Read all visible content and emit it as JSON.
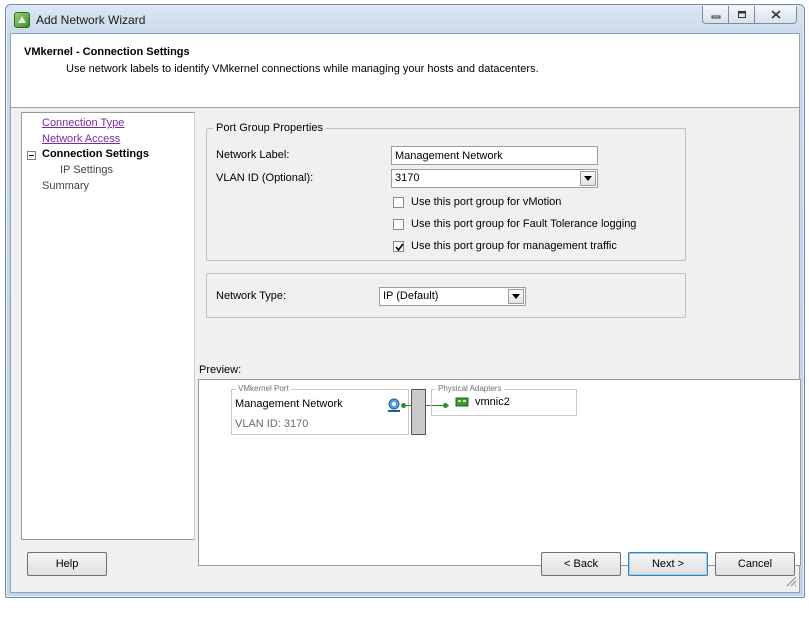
{
  "window": {
    "title": "Add Network Wizard",
    "buttons": {
      "minimize": "minimize",
      "maximize": "maximize",
      "close": "close"
    }
  },
  "header": {
    "title": "VMkernel - Connection Settings",
    "description": "Use network labels to identify VMkernel connections while managing your hosts and datacenters."
  },
  "nav": {
    "items": [
      {
        "label": "Connection Type",
        "state": "visited"
      },
      {
        "label": "Network Access",
        "state": "visited"
      },
      {
        "label": "Connection Settings",
        "state": "current"
      },
      {
        "label": "IP Settings",
        "state": "sub"
      },
      {
        "label": "Summary",
        "state": "pending"
      }
    ]
  },
  "port_group": {
    "legend": "Port Group Properties",
    "network_label_caption": "Network Label:",
    "network_label_value": "Management Network",
    "vlan_caption": "VLAN ID (Optional):",
    "vlan_value": "3170",
    "checkboxes": [
      {
        "label": "Use this port group for vMotion",
        "checked": false
      },
      {
        "label": "Use this port group for Fault Tolerance logging",
        "checked": false
      },
      {
        "label": "Use this port group for management traffic",
        "checked": true
      }
    ]
  },
  "network_type": {
    "caption": "Network Type:",
    "value": "IP (Default)"
  },
  "preview": {
    "label": "Preview:",
    "vmkernel_caption": "VMkernel Port",
    "port_name": "Management Network",
    "vlan_text": "VLAN ID: 3170",
    "physical_caption": "Physical Adapters",
    "adapter": "vmnic2",
    "link_color": "#2f8a2f"
  },
  "buttons": {
    "help": "Help",
    "back": "< Back",
    "next": "Next >",
    "cancel": "Cancel"
  }
}
